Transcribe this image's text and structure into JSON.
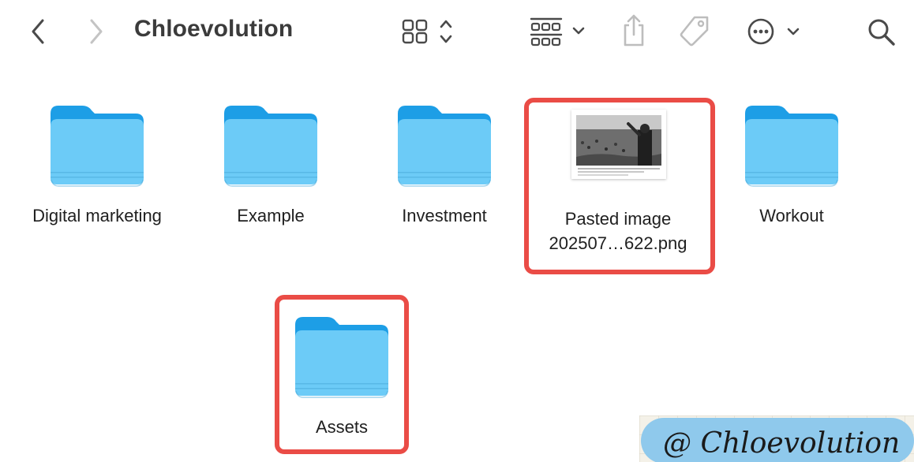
{
  "toolbar": {
    "title": "Chloevolution",
    "back": "back",
    "forward": "forward",
    "view_mode": "icon-view",
    "group": "group-by",
    "share": "share",
    "tag": "tag",
    "more": "more",
    "search": "search"
  },
  "files": [
    {
      "name": "Digital marketing",
      "kind": "folder"
    },
    {
      "name": "Example",
      "kind": "folder"
    },
    {
      "name": "Investment",
      "kind": "folder"
    },
    {
      "name_line1": "Pasted image",
      "name_line2": "202507…622.png",
      "kind": "image"
    },
    {
      "name": "Workout",
      "kind": "folder"
    },
    {
      "name": "Assets",
      "kind": "folder"
    }
  ],
  "watermark": {
    "text": "@ Chloevolution"
  },
  "colors": {
    "folder_back": "#1d9ee6",
    "folder_front": "#6ccbf7",
    "highlight": "#ea4c46",
    "watermark_bg": "#8fc9ec"
  }
}
